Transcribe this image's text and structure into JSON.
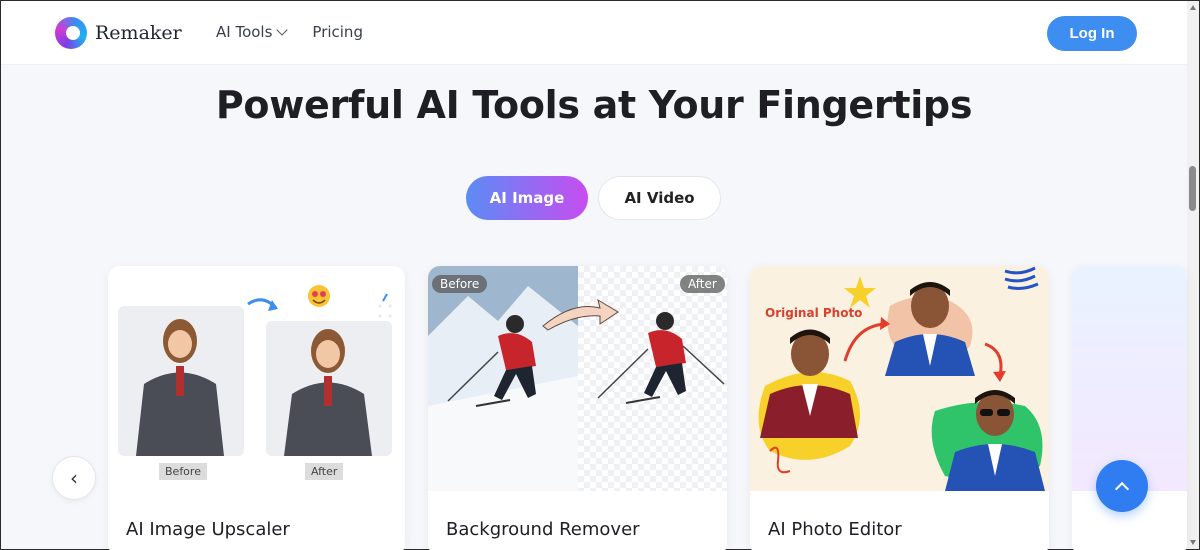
{
  "header": {
    "brand": "Remaker",
    "nav": [
      {
        "label": "AI Tools",
        "has_dropdown": true
      },
      {
        "label": "Pricing",
        "has_dropdown": false
      }
    ],
    "login_label": "Log In"
  },
  "main": {
    "title": "Powerful AI Tools at Your Fingertips",
    "tabs": [
      {
        "label": "AI Image",
        "active": true
      },
      {
        "label": "AI Video",
        "active": false
      }
    ],
    "cards": [
      {
        "title": "AI Image Upscaler",
        "before_label": "Before",
        "after_label": "After"
      },
      {
        "title": "Background Remover",
        "before_label": "Before",
        "after_label": "After"
      },
      {
        "title": "AI Photo Editor",
        "overlay_label": "Original Photo"
      }
    ]
  },
  "controls": {
    "prev_icon": "chevron-left-icon",
    "prev_glyph": "‹",
    "back_to_top_icon": "chevron-up-icon"
  },
  "colors": {
    "accent": "#3d8ef0",
    "tab_gradient_start": "#5b8cf5",
    "tab_gradient_end": "#c74df0",
    "back_to_top": "#2f7df0"
  }
}
